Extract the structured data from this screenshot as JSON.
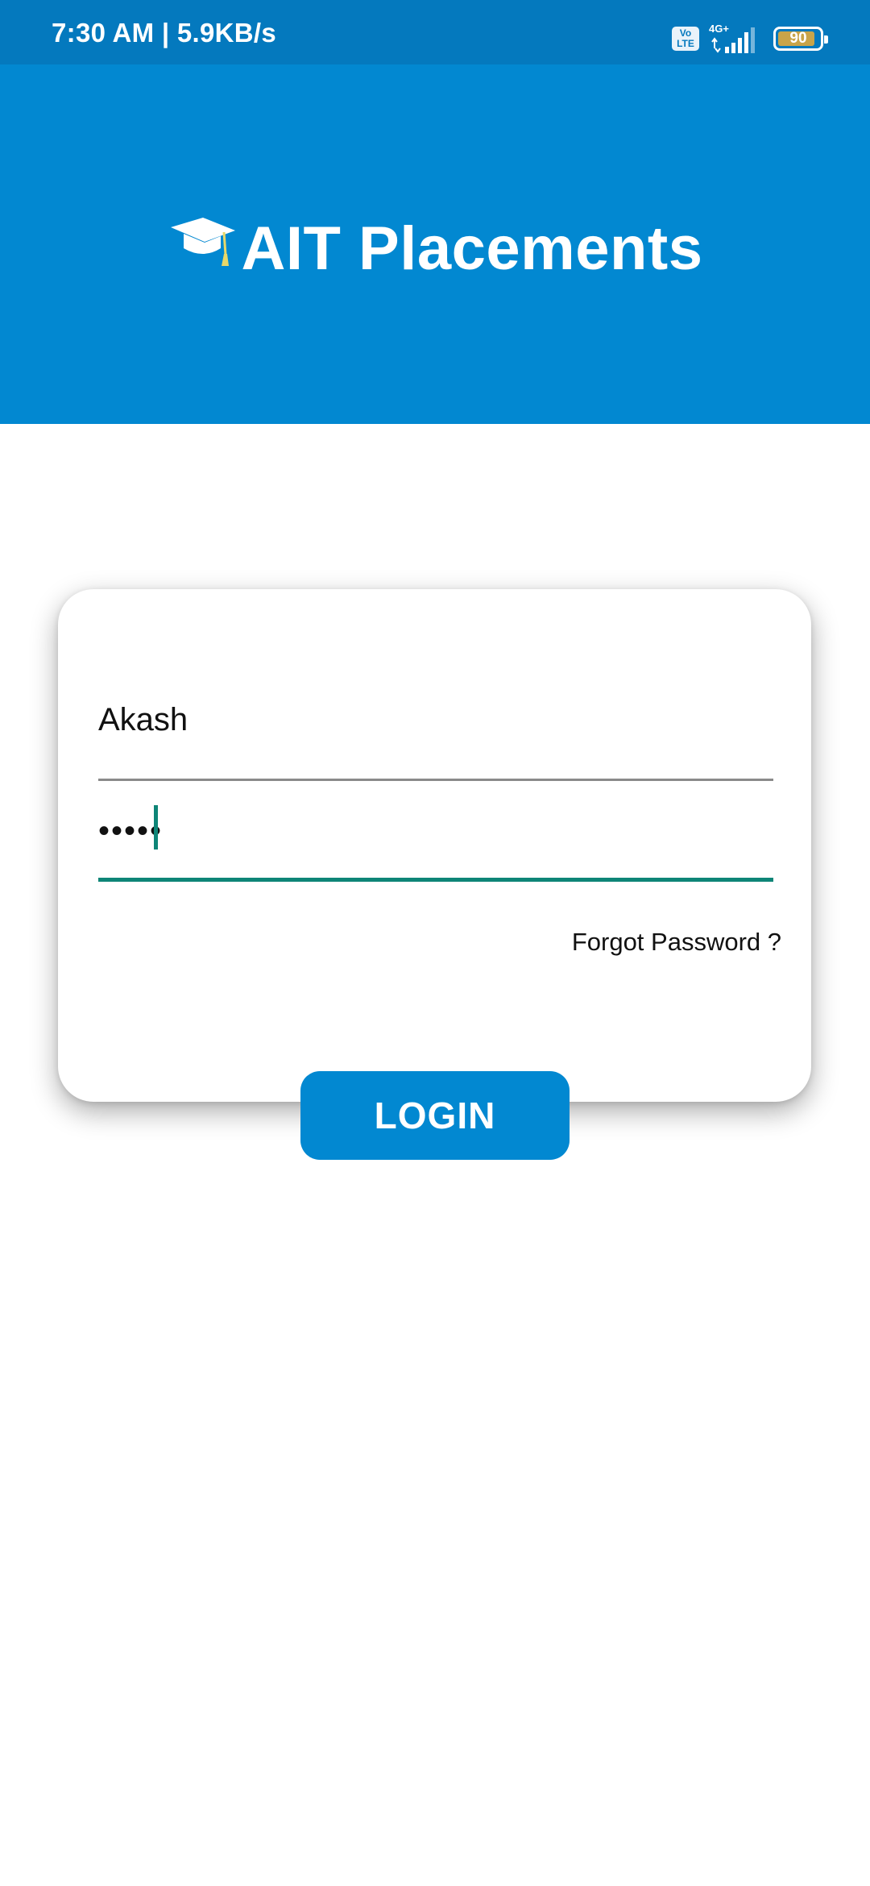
{
  "status_bar": {
    "time_speed": "7:30 AM | 5.9KB/s",
    "volte_top": "Vo",
    "volte_bottom": "LTE",
    "network": "4G+",
    "battery": "90"
  },
  "header": {
    "title": "AIT Placements",
    "icon": "graduation-cap-icon"
  },
  "login_form": {
    "username_value": "Akash",
    "password_value": "•••••",
    "forgot_password": "Forgot Password ?",
    "login_button": "LOGIN"
  },
  "colors": {
    "status_bar": "#0479BE",
    "header": "#0288D1",
    "accent_teal": "#0E8577",
    "button": "#0288D1"
  }
}
